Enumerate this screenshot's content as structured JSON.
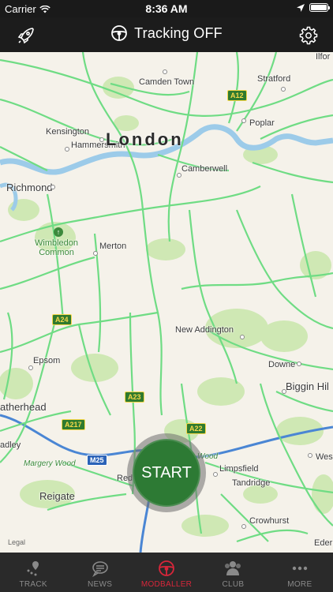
{
  "status_bar": {
    "carrier": "Carrier",
    "time": "8:36 AM"
  },
  "header": {
    "title": "Tracking OFF",
    "left_icon": "rocket-icon",
    "title_icon": "steering-wheel-icon",
    "right_icon": "gear-icon"
  },
  "map": {
    "city": "London",
    "places": {
      "camden_town": "Camden Town",
      "stratford": "Stratford",
      "ilford": "Ilfor",
      "kensington": "Kensington",
      "hammersmith": "Hammersmith",
      "poplar": "Poplar",
      "camberwell": "Camberwell",
      "richmond": "Richmond",
      "wimbledon_common": "Wimbledon\nCommon",
      "merton": "Merton",
      "new_addington": "New Addington",
      "epsom": "Epsom",
      "downe": "Downe",
      "biggin_hill": "Biggin Hil",
      "leatherhead": "atherhead",
      "redhill_partial": "adley",
      "margery_wood": "Margery Wood",
      "reigate": "Reigate",
      "redhill": "Red",
      "wood": "Wood",
      "limpsfield": "Limpsfield",
      "tandridge": "Tandridge",
      "westerham": "Wes",
      "crowhurst": "Crowhurst",
      "edenbridge": "Eder"
    },
    "roads": {
      "a12": "A12",
      "a24": "A24",
      "a23": "A23",
      "a22": "A22",
      "a217": "A217",
      "m25": "M25"
    },
    "legal": "Legal",
    "colors": {
      "land": "#f5f2ea",
      "park": "#cfe8b4",
      "road": "#6fdc84",
      "water": "#9ccbe9",
      "motorway": "#4a86d4"
    }
  },
  "start_button": {
    "label": "START",
    "color": "#2d7a34"
  },
  "tab_bar": {
    "tabs": [
      {
        "label": "TRACK",
        "icon": "track-pin-icon",
        "active": false
      },
      {
        "label": "NEWS",
        "icon": "news-bubble-icon",
        "active": false
      },
      {
        "label": "MODBALLER",
        "icon": "steering-wheel-icon",
        "active": true
      },
      {
        "label": "CLUB",
        "icon": "club-people-icon",
        "active": false
      },
      {
        "label": "MORE",
        "icon": "more-dots-icon",
        "active": false
      }
    ],
    "active_color": "#d8263a"
  }
}
